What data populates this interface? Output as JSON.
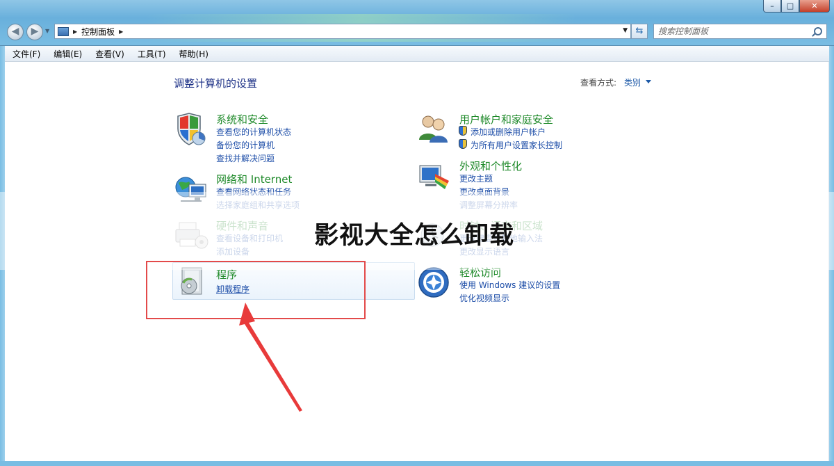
{
  "address": {
    "breadcrumb": "控制面板",
    "search_placeholder": "搜索控制面板"
  },
  "menu": [
    "文件(F)",
    "编辑(E)",
    "查看(V)",
    "工具(T)",
    "帮助(H)"
  ],
  "heading": "调整计算机的设置",
  "view_by": {
    "label": "查看方式:",
    "value": "类别"
  },
  "categories": {
    "system": {
      "title": "系统和安全",
      "links": [
        "查看您的计算机状态",
        "备份您的计算机",
        "查找并解决问题"
      ]
    },
    "network": {
      "title": "网络和 Internet",
      "links": [
        "查看网络状态和任务",
        "选择家庭组和共享选项"
      ]
    },
    "hardware": {
      "title": "硬件和声音",
      "links": [
        "查看设备和打印机",
        "添加设备"
      ]
    },
    "programs": {
      "title": "程序",
      "links": [
        "卸载程序"
      ]
    },
    "users": {
      "title": "用户帐户和家庭安全",
      "links": [
        "添加或删除用户帐户",
        "为所有用户设置家长控制"
      ]
    },
    "appearance": {
      "title": "外观和个性化",
      "links": [
        "更改主题",
        "更改桌面背景",
        "调整屏幕分辨率"
      ]
    },
    "clock": {
      "title": "时钟、语言和区域",
      "links": [
        "更改键盘或其他输入法",
        "更改显示语言"
      ]
    },
    "ease": {
      "title": "轻松访问",
      "links": [
        "使用 Windows 建议的设置",
        "优化视频显示"
      ]
    }
  },
  "overlay_caption": "影视大全怎么卸载",
  "colors": {
    "category_title": "#1f8a2a",
    "link": "#1e4ea8",
    "annotation": "#e34a4a"
  }
}
